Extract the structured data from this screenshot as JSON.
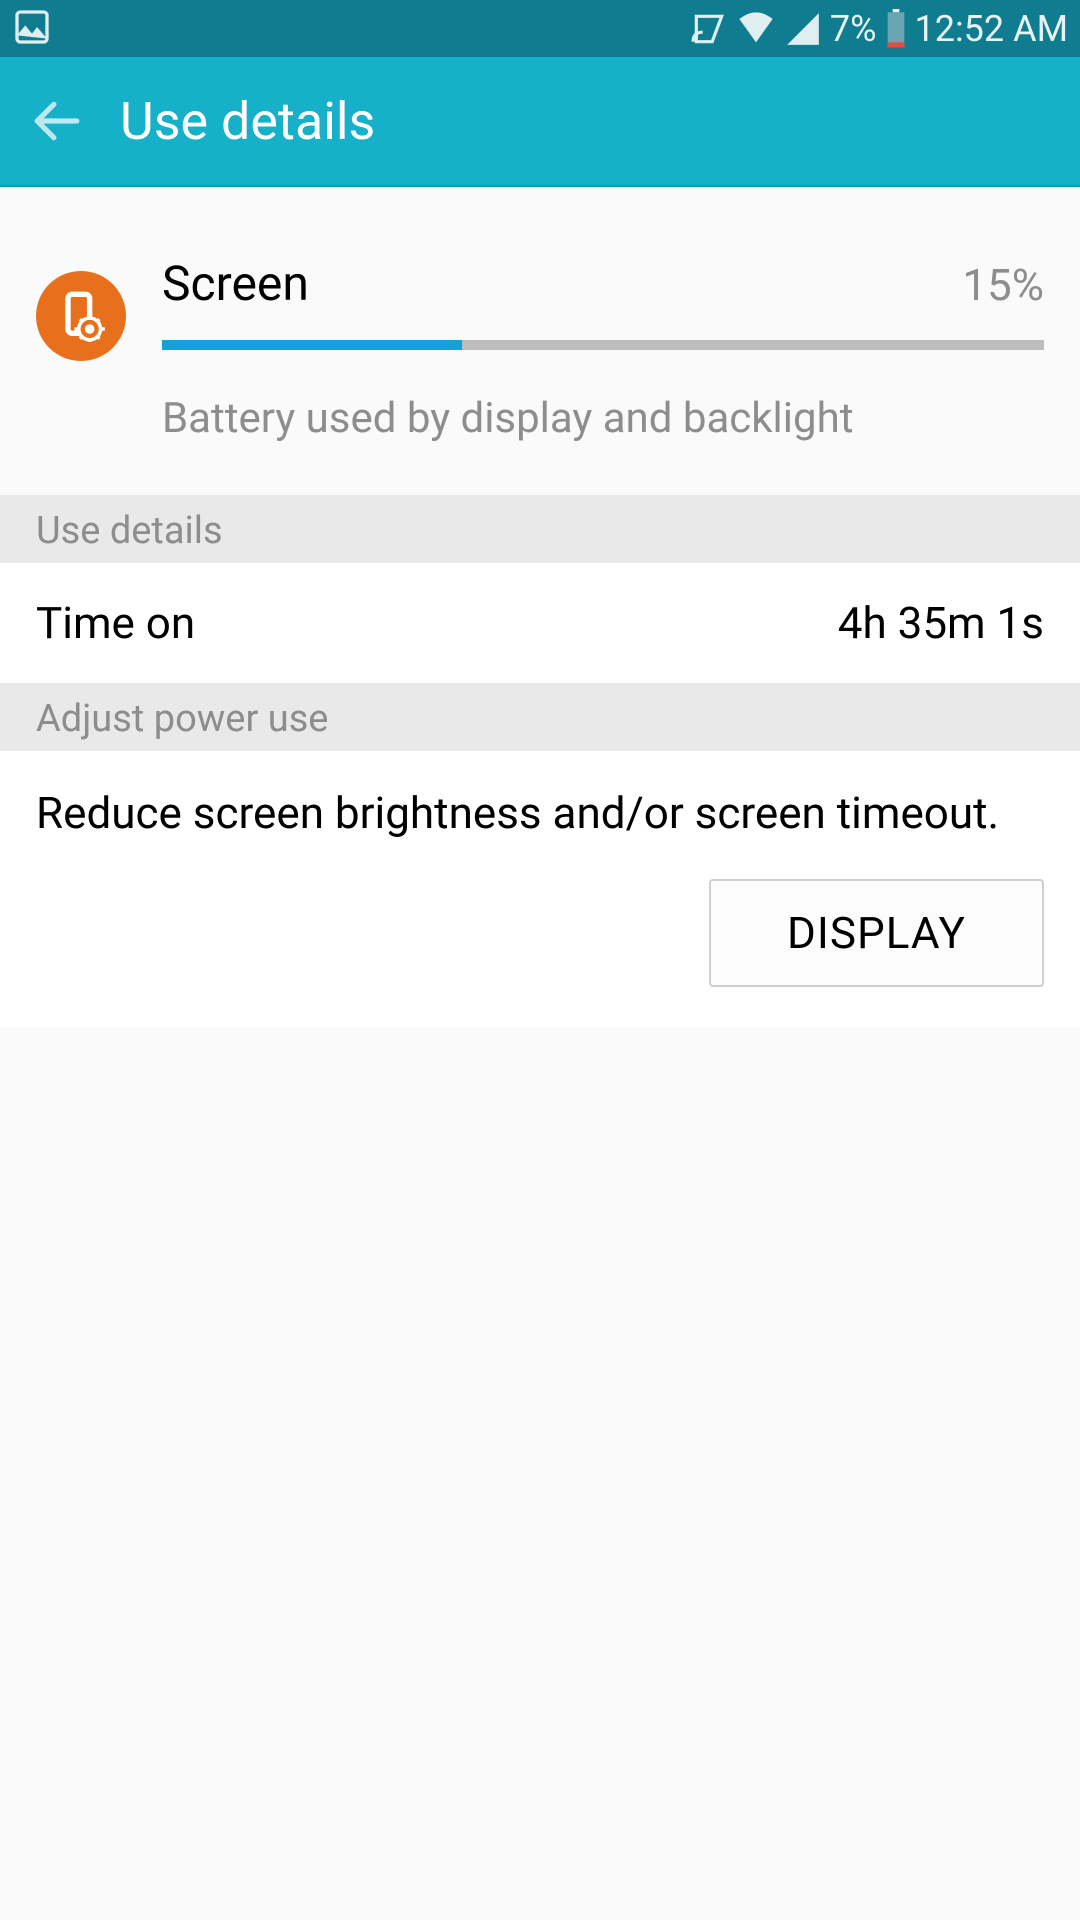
{
  "status_bar": {
    "battery_percent": "7%",
    "time": "12:52 AM"
  },
  "app_bar": {
    "title": "Use details"
  },
  "screen_info": {
    "name": "Screen",
    "percent": "15%",
    "progress_percent": 34,
    "description": "Battery used by display and backlight"
  },
  "use_details": {
    "header": "Use details",
    "time_on_label": "Time on",
    "time_on_value": "4h 35m 1s"
  },
  "adjust_power": {
    "header": "Adjust power use",
    "text": "Reduce screen brightness and/or screen timeout.",
    "button_label": "DISPLAY"
  }
}
